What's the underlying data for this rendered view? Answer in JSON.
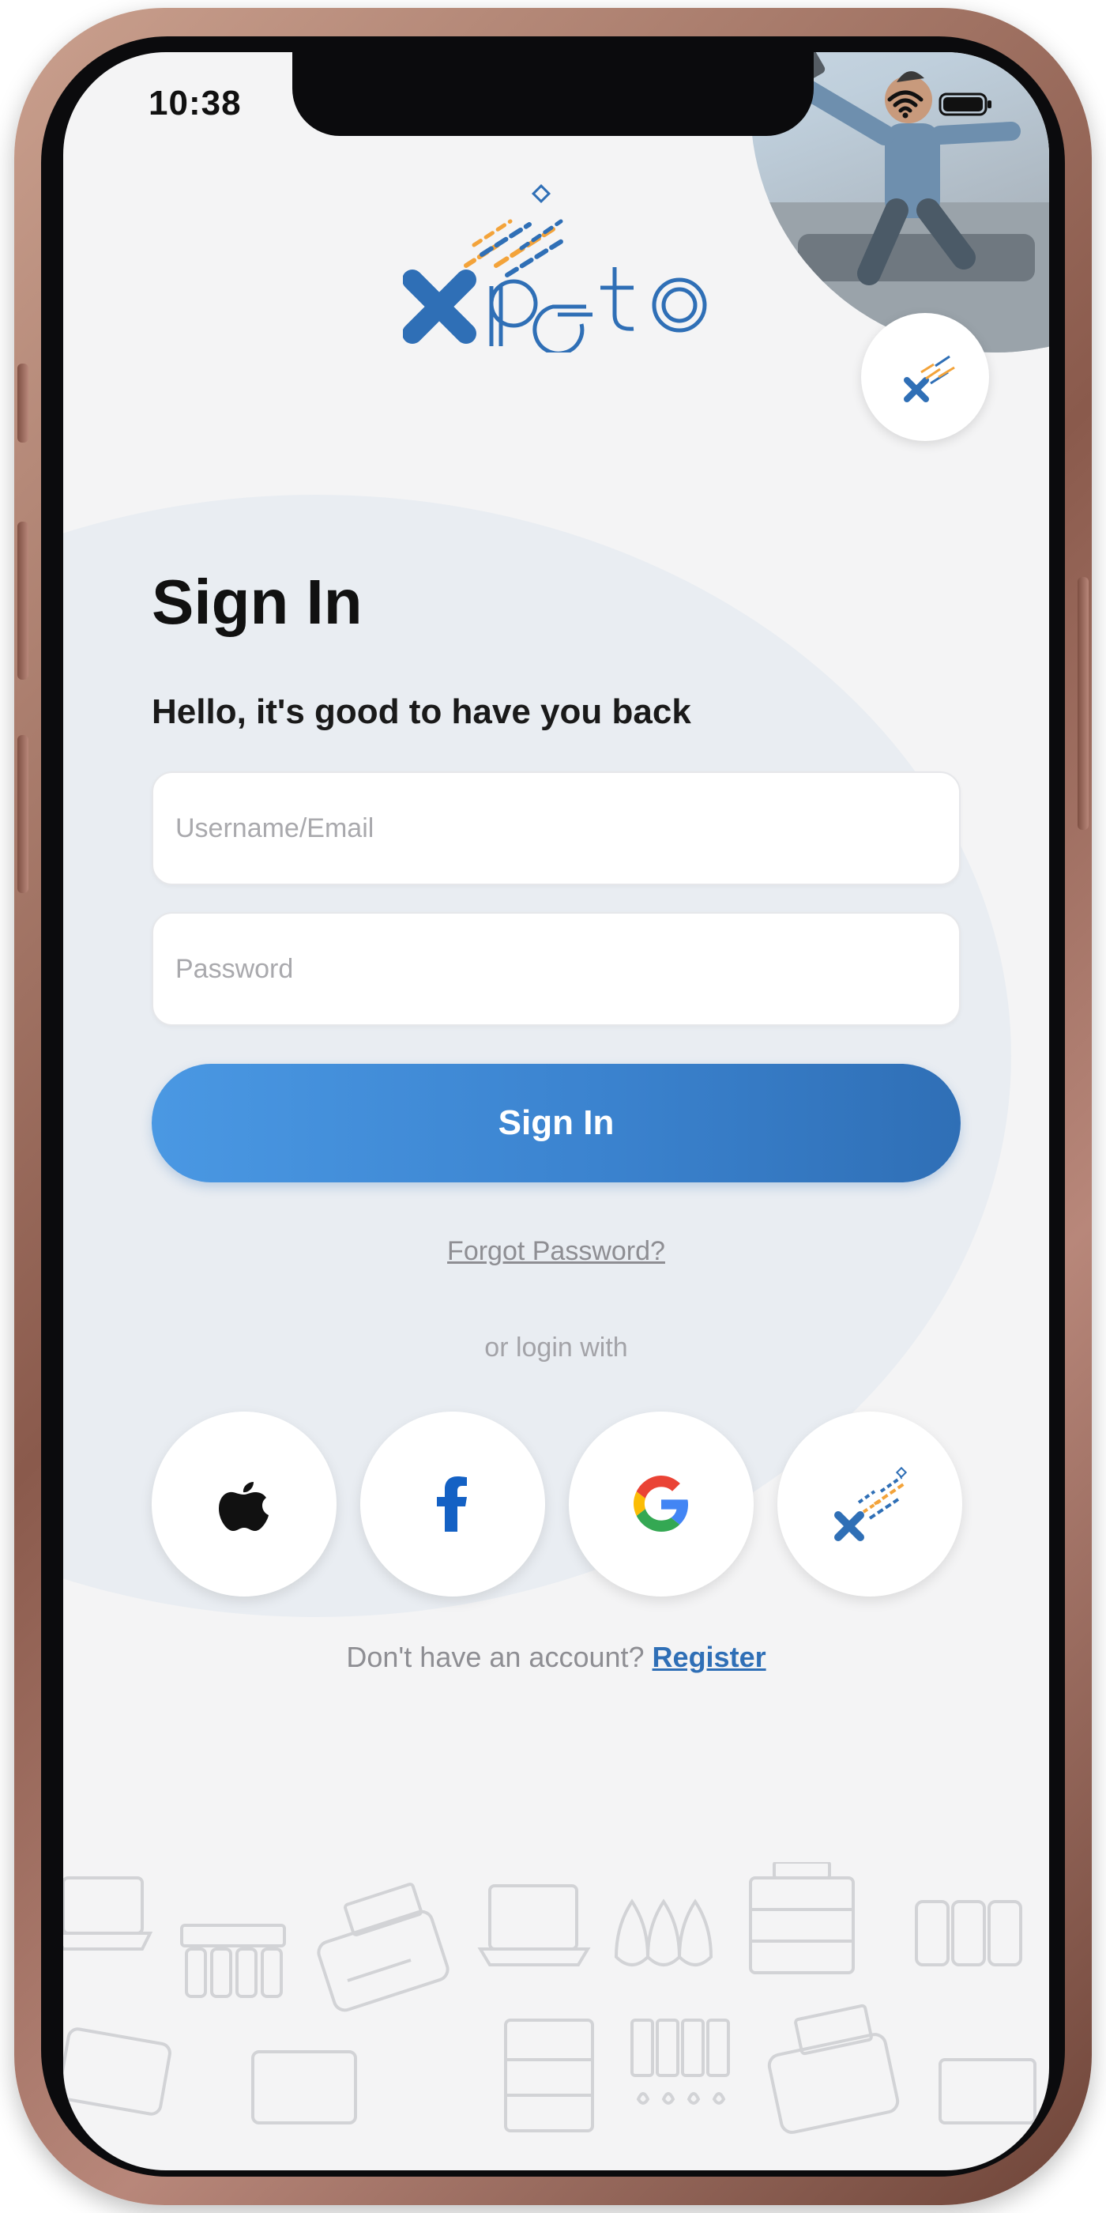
{
  "status_bar": {
    "time": "10:38",
    "icons": [
      "wifi-icon",
      "battery-icon"
    ]
  },
  "brand": {
    "logo_text": "xpeto",
    "colors": {
      "primary_blue": "#2f6fb6",
      "accent_orange": "#f3a33a",
      "background": "#f4f4f5"
    }
  },
  "header": {
    "title": "Sign In",
    "subtitle": "Hello, it's good to have you back"
  },
  "form": {
    "username_placeholder": "Username/Email",
    "username_value": "",
    "password_placeholder": "Password",
    "password_value": "",
    "submit_label": "Sign In"
  },
  "links": {
    "forgot_password": "Forgot Password?",
    "or_login_with": "or login with",
    "no_account": "Don't have an account?",
    "register": "Register"
  },
  "social_logins": [
    {
      "name": "apple",
      "icon": "apple-icon"
    },
    {
      "name": "facebook",
      "icon": "facebook-icon"
    },
    {
      "name": "google",
      "icon": "google-icon"
    },
    {
      "name": "xpeto",
      "icon": "xpeto-icon"
    }
  ],
  "decorations": {
    "footer_icons": [
      "laptop-icon",
      "ink-cartridge-icon",
      "printer-icon",
      "laptop-icon",
      "ink-drops-icon",
      "copier-icon",
      "ink-cartridges-icon"
    ]
  }
}
